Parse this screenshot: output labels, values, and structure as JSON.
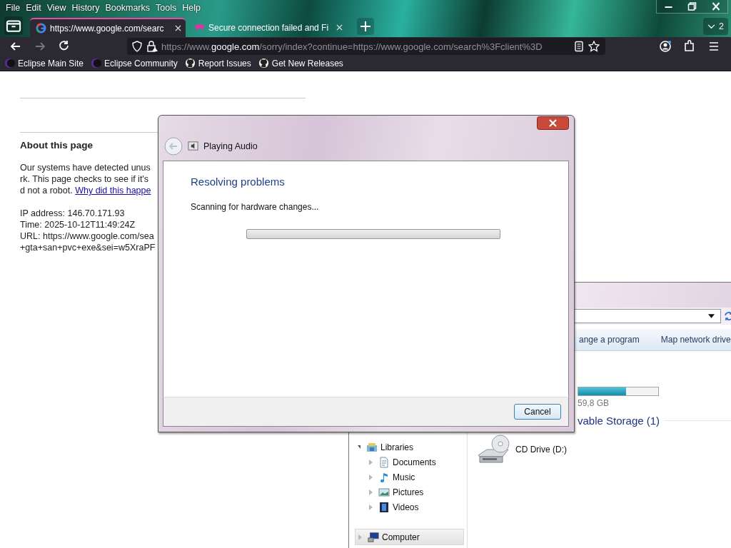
{
  "browser": {
    "menu": [
      "File",
      "Edit",
      "View",
      "History",
      "Bookmarks",
      "Tools",
      "Help"
    ],
    "tabs": [
      {
        "title": "https://www.google.com/searc",
        "selected": true,
        "kind": "google"
      },
      {
        "title": "Secure connection failed and Fi",
        "selected": false,
        "kind": "mask"
      }
    ],
    "tab_count": "2",
    "url": "https://www.**google.com**/sorry/index?continue=https://www.google.com/search%3Fclient%3D",
    "bookmarks": [
      {
        "label": "Eclipse Main Site",
        "kind": "eclipse"
      },
      {
        "label": "Eclipse Community",
        "kind": "eclipse"
      },
      {
        "label": "Report Issues",
        "kind": "github"
      },
      {
        "label": "Get New Releases",
        "kind": "github"
      }
    ]
  },
  "page": {
    "heading": "About this page",
    "paragraph": [
      {
        "text": "Our systems have detected unus"
      },
      {
        "text": "rk. This page checks to see if it's"
      },
      {
        "text": "d not a robot.",
        "link": "Why did this happe"
      }
    ],
    "details": [
      "IP address: 146.70.171.93",
      "Time: 2025-10-12T11:49:24Z",
      "URL: https://www.google.com/sea",
      "+gta+san+pvc+exe&sei=w5XraPF"
    ]
  },
  "dialog": {
    "title": "Playing Audio",
    "heading": "Resolving problems",
    "status": "Scanning for hardware changes...",
    "progress": {
      "level": 0
    },
    "buttons": [
      "Cancel"
    ]
  },
  "explorer": {
    "toolbar": [
      "ange a program",
      "Map network drive"
    ],
    "drive_bar": {
      "level": 0.6
    },
    "drive_size": "59,8 GB",
    "section": "vable Storage (1)",
    "nav": [
      {
        "label": "Libraries",
        "kind": "library",
        "expanded": true,
        "selected": false,
        "children": [
          {
            "label": "Documents",
            "kind": "document",
            "expanded": false,
            "selected": false
          },
          {
            "label": "Music",
            "kind": "music",
            "expanded": false,
            "selected": false
          },
          {
            "label": "Pictures",
            "kind": "picture",
            "expanded": false,
            "selected": false
          },
          {
            "label": "Videos",
            "kind": "video",
            "expanded": false,
            "selected": false
          }
        ]
      },
      {
        "label": "Computer",
        "kind": "computer",
        "expanded": false,
        "selected": true
      }
    ],
    "drives": [
      {
        "label": "CD Drive (D:)"
      }
    ]
  }
}
